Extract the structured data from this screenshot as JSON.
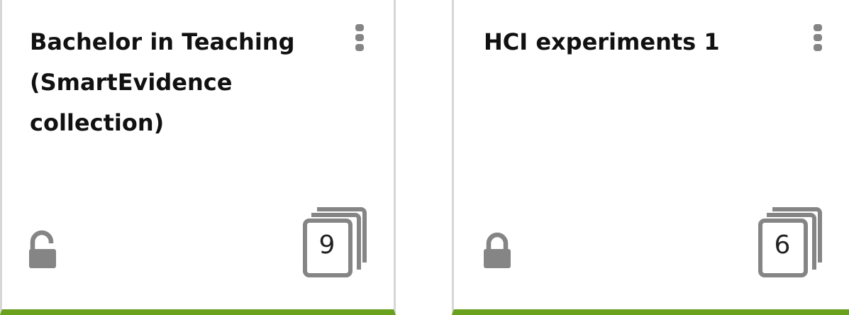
{
  "colors": {
    "accent_bar": "#6aa11c",
    "icon_gray": "#858585",
    "border": "#d6d6d6",
    "title": "#111111"
  },
  "cards": [
    {
      "title": "Bachelor in Teaching (SmartEvidence collection)",
      "lock_icon": "unlocked-padlock-icon",
      "menu_icon": "kebab-menu-icon",
      "pages_icon": "stacked-pages-icon",
      "count": "9"
    },
    {
      "title": "HCI experiments 1",
      "lock_icon": "locked-padlock-icon",
      "menu_icon": "kebab-menu-icon",
      "pages_icon": "stacked-pages-icon",
      "count": "6"
    }
  ]
}
